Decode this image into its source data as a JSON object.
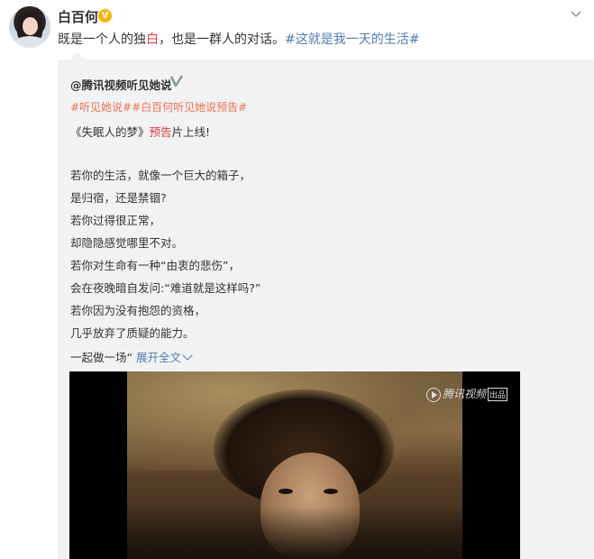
{
  "post": {
    "username": "白百何",
    "verified_badge": "V",
    "text_before": "既是一个人的独",
    "text_red": "白",
    "text_middle": "，也是一群人的对话。",
    "topic": "#这就是我一天的生活#"
  },
  "repost": {
    "username": "@腾讯视频听见她说",
    "topics": "#听见她说##白百何听见她说预告#",
    "line1_before": "《失眠人的梦》",
    "line1_red": "预告",
    "line1_after": "片上线!",
    "lines": [
      "若你的生活，就像一个巨大的箱子，",
      "是归宿，还是禁锢?",
      "若你过得很正常，",
      "却隐隐感觉哪里不对。",
      "若你对生命有一种“由衷的悲伤”，",
      "会在夜晚暗自发问:“难道就是这样吗?”",
      "若你因为没有抱怨的资格，",
      "几乎放弃了质疑的能力。"
    ],
    "last_line": "一起做一场“",
    "expand_label": "展开全文"
  },
  "video": {
    "watermark_text": "腾讯视频",
    "watermark_tag": "出品"
  },
  "colors": {
    "link_blue": "#507daf",
    "topic_orange": "#eb7350",
    "red": "#e6393f",
    "repost_bg": "#f2f2f5",
    "badge_yellow": "#f7b500"
  },
  "icons": [
    "avatar",
    "verified-v-icon",
    "chevron-down-icon",
    "blue-verified-icon",
    "play-logo-icon"
  ]
}
